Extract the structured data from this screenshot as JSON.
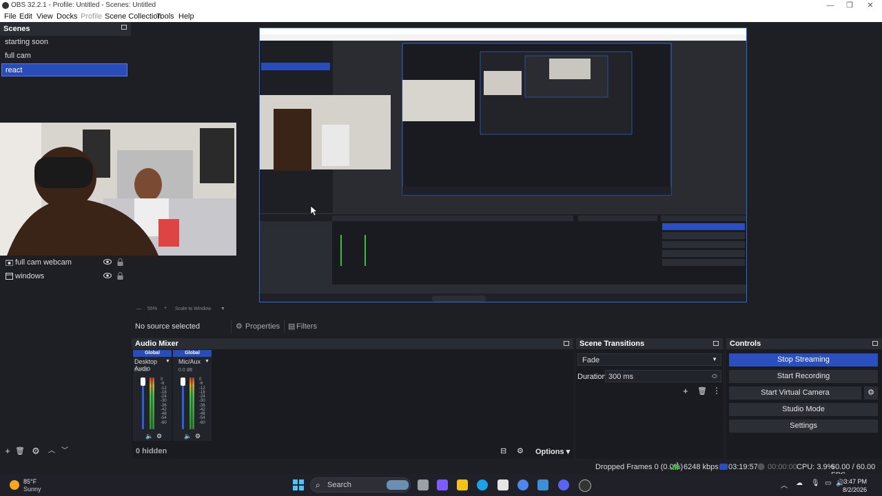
{
  "window": {
    "title": "OBS 32.2.1 - Profile: Untitled - Scenes: Untitled"
  },
  "menu": [
    "File",
    "Edit",
    "View",
    "Docks",
    "Profile",
    "Scene Collection",
    "Tools",
    "Help"
  ],
  "scenes": {
    "title": "Scenes",
    "items": [
      "starting soon",
      "full cam",
      "react"
    ],
    "selected": "react"
  },
  "sources": {
    "items": [
      "full cam webcam",
      "windows"
    ],
    "hidden_count": "0 hidden"
  },
  "preview": {
    "zoom": "55%",
    "scale_mode": "Scale to Window"
  },
  "source_bar": {
    "no_source": "No source selected",
    "properties": "Properties",
    "filters": "Filters"
  },
  "mixer": {
    "title": "Audio Mixer",
    "channels": [
      {
        "scope": "Global",
        "name": "Desktop Audio",
        "level": "0.0 dB"
      },
      {
        "scope": "Global",
        "name": "Mic/Aux",
        "level": "0.0 dB"
      }
    ],
    "scale": [
      "0",
      "-6",
      "-12",
      "-18",
      "-24",
      "-30",
      "-36",
      "-42",
      "-48",
      "-54",
      "-60"
    ],
    "hidden": "0 hidden",
    "options": "Options"
  },
  "transitions": {
    "title": "Scene Transitions",
    "selected": "Fade",
    "duration_label": "Duration",
    "duration_value": "300 ms"
  },
  "controls": {
    "title": "Controls",
    "buttons": [
      "Stop Streaming",
      "Start Recording",
      "Start Virtual Camera",
      "Studio Mode",
      "Settings"
    ]
  },
  "status": {
    "dropped": "Dropped Frames 0 (0.0%)",
    "bitrate": "6248 kbps",
    "stream_time": "03:19:57",
    "rec_time": "00:00:00",
    "cpu": "CPU: 3.9%",
    "fps": "60.00 / 60.00 FPS"
  },
  "taskbar": {
    "weather_temp": "85°F",
    "weather_desc": "Sunny",
    "search": "Search",
    "time": "3:47 PM",
    "date": "8/2/2026"
  }
}
